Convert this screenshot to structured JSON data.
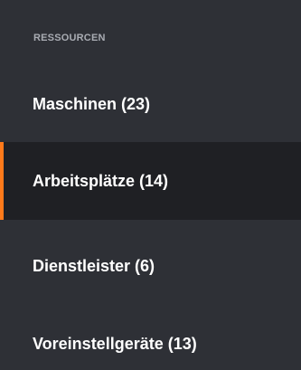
{
  "sidebar": {
    "section_title": "RESSOURCEN",
    "accent_color": "#ff7a1a",
    "items": [
      {
        "label": "Maschinen (23)",
        "active": false
      },
      {
        "label": "Arbeitsplätze (14)",
        "active": true
      },
      {
        "label": "Dienstleister (6)",
        "active": false
      },
      {
        "label": "Voreinstellgeräte (13)",
        "active": false
      }
    ]
  }
}
